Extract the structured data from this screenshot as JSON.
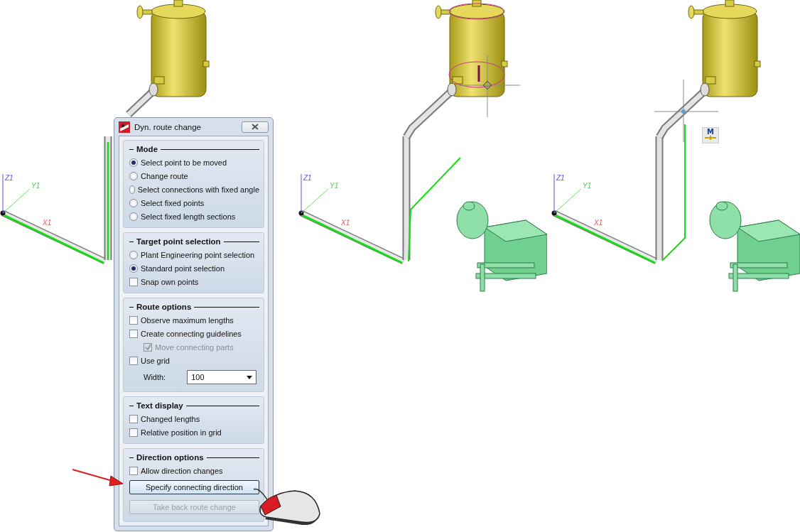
{
  "scenes": [
    {
      "kind": "original",
      "axes": {
        "z": "Z1",
        "y": "Y1",
        "x": "X1"
      }
    },
    {
      "kind": "moved",
      "axes": {
        "z": "Z1",
        "y": "Y1",
        "x": "X1"
      }
    },
    {
      "kind": "direction",
      "axes": {
        "z": "Z1",
        "y": "Y1",
        "x": "X1"
      },
      "marker": "M"
    }
  ],
  "dialog": {
    "title": "Dyn. route change",
    "groups": [
      {
        "title": "Mode",
        "items": [
          {
            "kind": "radio",
            "label": "Select point to be moved",
            "selected": true
          },
          {
            "kind": "radio",
            "label": "Change route",
            "selected": false
          },
          {
            "kind": "radio",
            "label": "Select connections with fixed angle",
            "selected": false
          },
          {
            "kind": "radio",
            "label": "Select fixed points",
            "selected": false
          },
          {
            "kind": "radio",
            "label": "Select fixed length sections",
            "selected": false
          }
        ]
      },
      {
        "title": "Target point selection",
        "items": [
          {
            "kind": "radio",
            "label": "Plant Engineering point selection",
            "selected": false
          },
          {
            "kind": "radio",
            "label": "Standard point selection",
            "selected": true
          },
          {
            "kind": "checkbox",
            "label": "Snap own points",
            "checked": false,
            "disabled": false
          }
        ]
      },
      {
        "title": "Route options",
        "items": [
          {
            "kind": "checkbox",
            "label": "Observe maximum lengths",
            "checked": false,
            "disabled": false
          },
          {
            "kind": "checkbox",
            "label": "Create connecting guidelines",
            "checked": false,
            "disabled": false,
            "children": [
              {
                "kind": "checkbox",
                "label": "Move connecting parts",
                "checked": true,
                "disabled": true
              }
            ]
          },
          {
            "kind": "checkbox",
            "label": "Use grid",
            "checked": false,
            "disabled": false
          },
          {
            "kind": "dropdown",
            "label": "Width:",
            "value": "100"
          }
        ]
      },
      {
        "title": "Text display",
        "items": [
          {
            "kind": "checkbox",
            "label": "Changed lengths",
            "checked": false,
            "disabled": false
          },
          {
            "kind": "checkbox",
            "label": "Relative position in grid",
            "checked": false,
            "disabled": false
          }
        ]
      },
      {
        "title": "Direction options",
        "items": [
          {
            "kind": "checkbox",
            "label": "Allow direction changes",
            "checked": false,
            "disabled": false
          },
          {
            "kind": "button",
            "label": "Specify connecting direction",
            "disabled": false
          },
          {
            "kind": "button",
            "label": "Take back route change",
            "disabled": true
          }
        ]
      }
    ]
  }
}
